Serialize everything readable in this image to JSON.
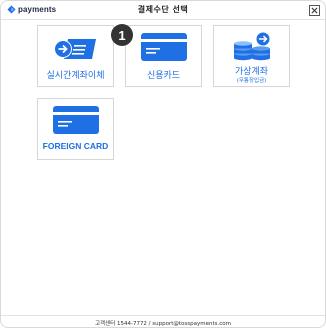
{
  "header": {
    "brand": "payments",
    "title": "결제수단 선택",
    "close_icon": "close-icon"
  },
  "step_badge": "1",
  "payment_methods": [
    {
      "label": "실시간계좌이체",
      "sublabel": "",
      "icon": "bank-transfer-icon"
    },
    {
      "label": "신용카드",
      "sublabel": "",
      "icon": "credit-card-icon"
    },
    {
      "label": "가상계좌",
      "sublabel": "(무통장입금)",
      "icon": "coins-stack-icon"
    },
    {
      "label": "FOREIGN CARD",
      "sublabel": "",
      "icon": "foreign-card-icon"
    }
  ],
  "footer": {
    "text": "고객센터 1544-7772 / support@tosspayments.com"
  },
  "colors": {
    "accent": "#1f6fe5",
    "card_border": "#d6d6d6",
    "badge": "#333333"
  }
}
